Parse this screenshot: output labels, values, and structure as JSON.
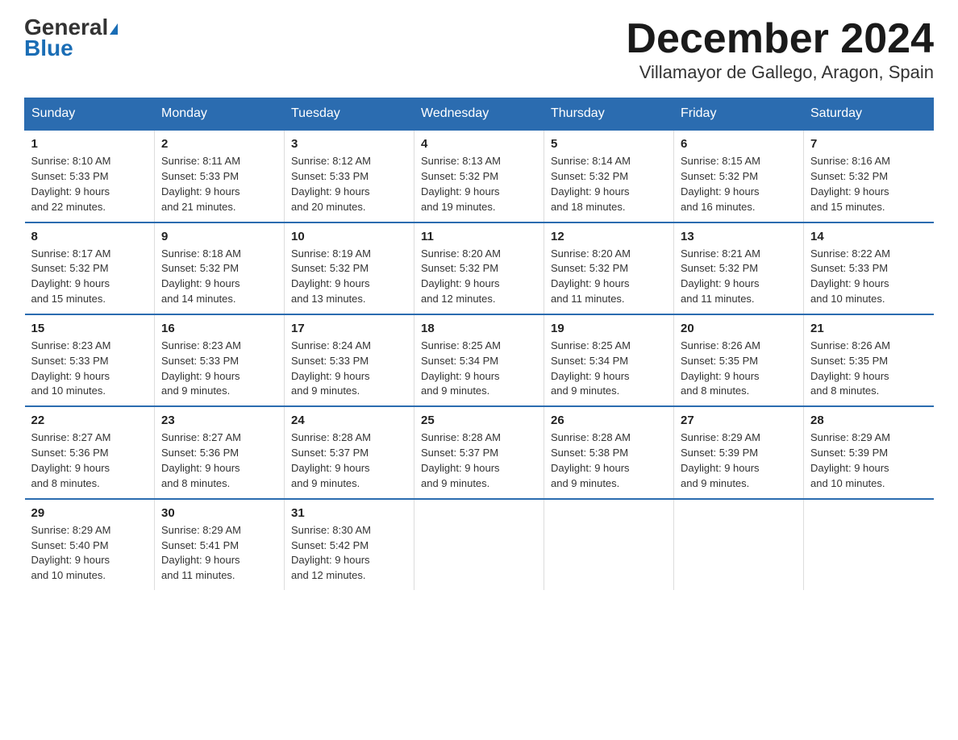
{
  "logo": {
    "line1": "General",
    "line2": "Blue"
  },
  "title": "December 2024",
  "subtitle": "Villamayor de Gallego, Aragon, Spain",
  "days_header": [
    "Sunday",
    "Monday",
    "Tuesday",
    "Wednesday",
    "Thursday",
    "Friday",
    "Saturday"
  ],
  "weeks": [
    [
      {
        "date": "1",
        "info": "Sunrise: 8:10 AM\nSunset: 5:33 PM\nDaylight: 9 hours\nand 22 minutes."
      },
      {
        "date": "2",
        "info": "Sunrise: 8:11 AM\nSunset: 5:33 PM\nDaylight: 9 hours\nand 21 minutes."
      },
      {
        "date": "3",
        "info": "Sunrise: 8:12 AM\nSunset: 5:33 PM\nDaylight: 9 hours\nand 20 minutes."
      },
      {
        "date": "4",
        "info": "Sunrise: 8:13 AM\nSunset: 5:32 PM\nDaylight: 9 hours\nand 19 minutes."
      },
      {
        "date": "5",
        "info": "Sunrise: 8:14 AM\nSunset: 5:32 PM\nDaylight: 9 hours\nand 18 minutes."
      },
      {
        "date": "6",
        "info": "Sunrise: 8:15 AM\nSunset: 5:32 PM\nDaylight: 9 hours\nand 16 minutes."
      },
      {
        "date": "7",
        "info": "Sunrise: 8:16 AM\nSunset: 5:32 PM\nDaylight: 9 hours\nand 15 minutes."
      }
    ],
    [
      {
        "date": "8",
        "info": "Sunrise: 8:17 AM\nSunset: 5:32 PM\nDaylight: 9 hours\nand 15 minutes."
      },
      {
        "date": "9",
        "info": "Sunrise: 8:18 AM\nSunset: 5:32 PM\nDaylight: 9 hours\nand 14 minutes."
      },
      {
        "date": "10",
        "info": "Sunrise: 8:19 AM\nSunset: 5:32 PM\nDaylight: 9 hours\nand 13 minutes."
      },
      {
        "date": "11",
        "info": "Sunrise: 8:20 AM\nSunset: 5:32 PM\nDaylight: 9 hours\nand 12 minutes."
      },
      {
        "date": "12",
        "info": "Sunrise: 8:20 AM\nSunset: 5:32 PM\nDaylight: 9 hours\nand 11 minutes."
      },
      {
        "date": "13",
        "info": "Sunrise: 8:21 AM\nSunset: 5:32 PM\nDaylight: 9 hours\nand 11 minutes."
      },
      {
        "date": "14",
        "info": "Sunrise: 8:22 AM\nSunset: 5:33 PM\nDaylight: 9 hours\nand 10 minutes."
      }
    ],
    [
      {
        "date": "15",
        "info": "Sunrise: 8:23 AM\nSunset: 5:33 PM\nDaylight: 9 hours\nand 10 minutes."
      },
      {
        "date": "16",
        "info": "Sunrise: 8:23 AM\nSunset: 5:33 PM\nDaylight: 9 hours\nand 9 minutes."
      },
      {
        "date": "17",
        "info": "Sunrise: 8:24 AM\nSunset: 5:33 PM\nDaylight: 9 hours\nand 9 minutes."
      },
      {
        "date": "18",
        "info": "Sunrise: 8:25 AM\nSunset: 5:34 PM\nDaylight: 9 hours\nand 9 minutes."
      },
      {
        "date": "19",
        "info": "Sunrise: 8:25 AM\nSunset: 5:34 PM\nDaylight: 9 hours\nand 9 minutes."
      },
      {
        "date": "20",
        "info": "Sunrise: 8:26 AM\nSunset: 5:35 PM\nDaylight: 9 hours\nand 8 minutes."
      },
      {
        "date": "21",
        "info": "Sunrise: 8:26 AM\nSunset: 5:35 PM\nDaylight: 9 hours\nand 8 minutes."
      }
    ],
    [
      {
        "date": "22",
        "info": "Sunrise: 8:27 AM\nSunset: 5:36 PM\nDaylight: 9 hours\nand 8 minutes."
      },
      {
        "date": "23",
        "info": "Sunrise: 8:27 AM\nSunset: 5:36 PM\nDaylight: 9 hours\nand 8 minutes."
      },
      {
        "date": "24",
        "info": "Sunrise: 8:28 AM\nSunset: 5:37 PM\nDaylight: 9 hours\nand 9 minutes."
      },
      {
        "date": "25",
        "info": "Sunrise: 8:28 AM\nSunset: 5:37 PM\nDaylight: 9 hours\nand 9 minutes."
      },
      {
        "date": "26",
        "info": "Sunrise: 8:28 AM\nSunset: 5:38 PM\nDaylight: 9 hours\nand 9 minutes."
      },
      {
        "date": "27",
        "info": "Sunrise: 8:29 AM\nSunset: 5:39 PM\nDaylight: 9 hours\nand 9 minutes."
      },
      {
        "date": "28",
        "info": "Sunrise: 8:29 AM\nSunset: 5:39 PM\nDaylight: 9 hours\nand 10 minutes."
      }
    ],
    [
      {
        "date": "29",
        "info": "Sunrise: 8:29 AM\nSunset: 5:40 PM\nDaylight: 9 hours\nand 10 minutes."
      },
      {
        "date": "30",
        "info": "Sunrise: 8:29 AM\nSunset: 5:41 PM\nDaylight: 9 hours\nand 11 minutes."
      },
      {
        "date": "31",
        "info": "Sunrise: 8:30 AM\nSunset: 5:42 PM\nDaylight: 9 hours\nand 12 minutes."
      },
      {
        "date": "",
        "info": ""
      },
      {
        "date": "",
        "info": ""
      },
      {
        "date": "",
        "info": ""
      },
      {
        "date": "",
        "info": ""
      }
    ]
  ]
}
